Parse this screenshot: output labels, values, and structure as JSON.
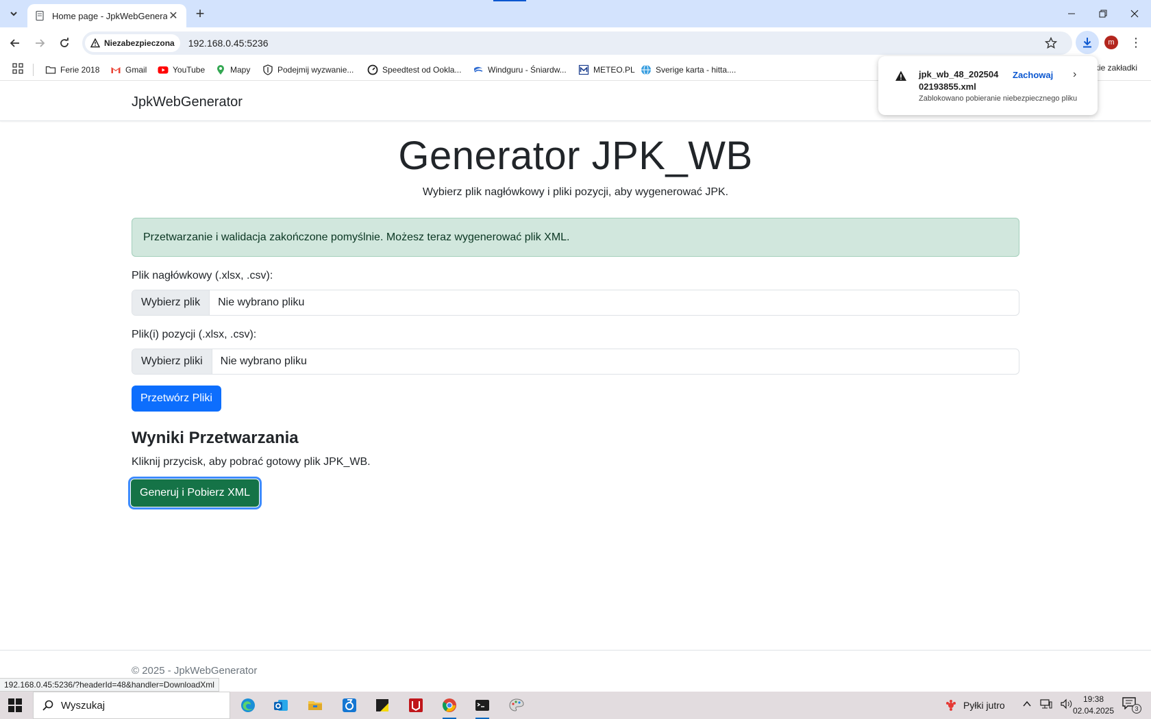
{
  "browser": {
    "tab_title": "Home page - JpkWebGenerator",
    "security_label": "Niezabezpieczona",
    "url": "192.168.0.45:5236",
    "avatar_letter": "m",
    "bookmarks": [
      {
        "label": "Ferie 2018",
        "icon": "folder-icon"
      },
      {
        "label": "Gmail",
        "icon": "gmail-icon"
      },
      {
        "label": "YouTube",
        "icon": "youtube-icon"
      },
      {
        "label": "Mapy",
        "icon": "maps-pin-icon"
      },
      {
        "label": "Podejmij wyzwanie...",
        "icon": "shield-icon"
      },
      {
        "label": "Speedtest od Ookla...",
        "icon": "speedometer-icon"
      },
      {
        "label": "Windguru - Śniardw...",
        "icon": "windguru-icon"
      },
      {
        "label": "METEO.PL",
        "icon": "meteo-icon"
      },
      {
        "label": "Sverige karta - hitta....",
        "icon": "globe-icon"
      }
    ],
    "bookmarks_right": "kie zakładki",
    "status_url": "192.168.0.45:5236/?headerId=48&handler=DownloadXml"
  },
  "download": {
    "filename": "jpk_wb_48_20250402193855.xml",
    "filename_line1": "jpk_wb_48_202504",
    "filename_line2": "02193855.xml",
    "keep_label": "Zachowaj",
    "status": "Zablokowano pobieranie niebezpiecznego pliku"
  },
  "page": {
    "brand": "JpkWebGenerator",
    "title": "Generator JPK_WB",
    "lead": "Wybierz plik nagłówkowy i pliki pozycji, aby wygenerować JPK.",
    "alert": "Przetwarzanie i walidacja zakończone pomyślnie. Możesz teraz wygenerować plik XML.",
    "header_file": {
      "label": "Plik nagłówkowy (.xlsx, .csv):",
      "button": "Wybierz plik",
      "value": "Nie wybrano pliku"
    },
    "position_files": {
      "label": "Plik(i) pozycji (.xlsx, .csv):",
      "button": "Wybierz pliki",
      "value": "Nie wybrano pliku"
    },
    "process_button": "Przetwórz Pliki",
    "results_heading": "Wyniki Przetwarzania",
    "results_text": "Kliknij przycisk, aby pobrać gotowy plik JPK_WB.",
    "generate_button": "Generuj i Pobierz XML",
    "footer": "© 2025 - JpkWebGenerator"
  },
  "taskbar": {
    "search_placeholder": "Wyszukaj",
    "weather": "Pyłki jutro",
    "time": "19:38",
    "date": "02.04.2025",
    "notification_count": "3",
    "apps": [
      "edge-icon",
      "outlook-icon",
      "file-explorer-icon",
      "store-app-icon",
      "sticky-notes-icon",
      "antivirus-icon",
      "chrome-icon",
      "terminal-icon",
      "paint-icon"
    ]
  },
  "colors": {
    "primary": "#0d6efd",
    "success": "#157347",
    "alert_bg": "#d1e7dd",
    "chrome_tab_strip": "#d3e3fd"
  }
}
